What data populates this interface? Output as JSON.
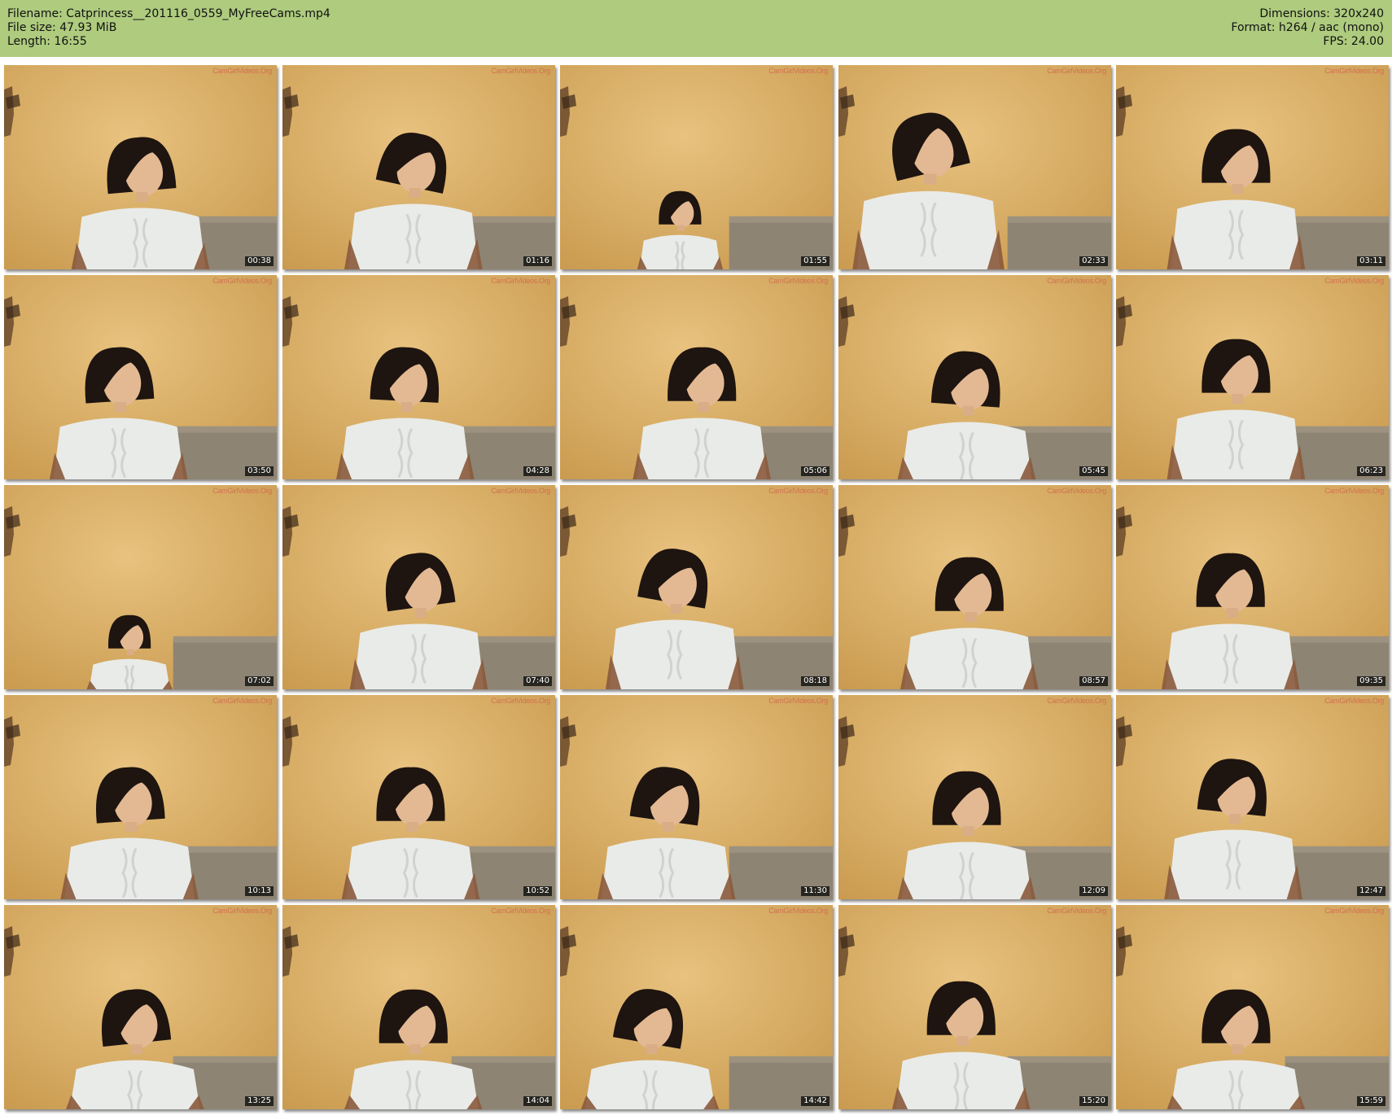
{
  "header": {
    "filename_line": "Filename: Catprincess__201116_0559_MyFreeCams.mp4",
    "filesize_line": "File size: 47.93 MiB",
    "length_line": "Length: 16:55",
    "dimensions_line": "Dimensions: 320x240",
    "format_line": "Format: h264 / aac (mono)",
    "fps_line": "FPS: 24.00",
    "background_color": "#aecb7e"
  },
  "watermark": "CamGirlVideos.Org",
  "thumbnails": [
    {
      "timestamp": "00:38"
    },
    {
      "timestamp": "01:16"
    },
    {
      "timestamp": "01:55"
    },
    {
      "timestamp": "02:33"
    },
    {
      "timestamp": "03:11"
    },
    {
      "timestamp": "03:50"
    },
    {
      "timestamp": "04:28"
    },
    {
      "timestamp": "05:06"
    },
    {
      "timestamp": "05:45"
    },
    {
      "timestamp": "06:23"
    },
    {
      "timestamp": "07:02"
    },
    {
      "timestamp": "07:40"
    },
    {
      "timestamp": "08:18"
    },
    {
      "timestamp": "08:57"
    },
    {
      "timestamp": "09:35"
    },
    {
      "timestamp": "10:13"
    },
    {
      "timestamp": "10:52"
    },
    {
      "timestamp": "11:30"
    },
    {
      "timestamp": "12:09"
    },
    {
      "timestamp": "12:47"
    },
    {
      "timestamp": "13:25"
    },
    {
      "timestamp": "14:04"
    },
    {
      "timestamp": "14:42"
    },
    {
      "timestamp": "15:20"
    },
    {
      "timestamp": "15:59"
    }
  ]
}
